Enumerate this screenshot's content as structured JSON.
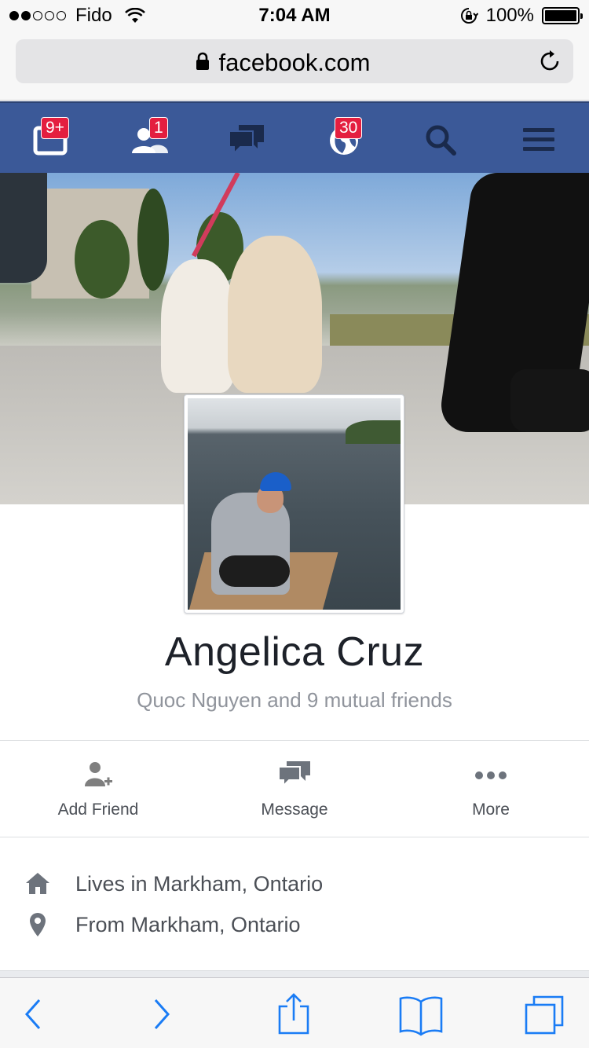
{
  "status_bar": {
    "carrier": "Fido",
    "time": "7:04 AM",
    "battery": "100%",
    "signal_bars_filled": 2,
    "signal_bars_total": 5
  },
  "browser": {
    "url": "facebook.com"
  },
  "fb_nav": {
    "friend_requests_badge": "9+",
    "people_badge": "1",
    "notifications_badge": "30"
  },
  "profile": {
    "name": "Angelica Cruz",
    "mutual_friends": "Quoc Nguyen and 9 mutual friends"
  },
  "actions": {
    "add_friend": "Add Friend",
    "message": "Message",
    "more": "More"
  },
  "info": {
    "lives_in": "Lives in Markham, Ontario",
    "from": "From Markham, Ontario"
  },
  "colors": {
    "fb_blue": "#3b5998",
    "badge_red": "#e41e3f",
    "ios_blue": "#1a7cf5"
  }
}
